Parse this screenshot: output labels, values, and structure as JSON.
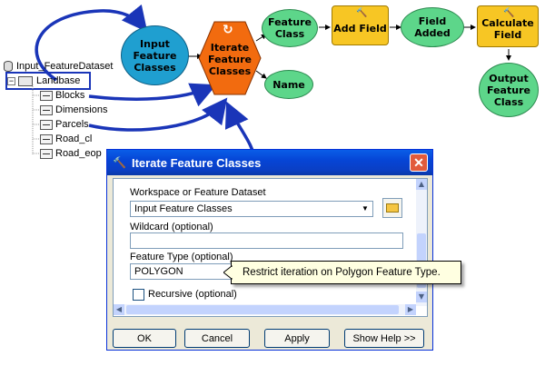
{
  "model": {
    "input_feature_classes": "Input Feature Classes",
    "iterate_feature_classes": "Iterate Feature Classes",
    "feature_class": "Feature Class",
    "name": "Name",
    "add_field": "Add Field",
    "field_added": "Field Added",
    "calculate_field": "Calculate Field",
    "output_feature_class": "Output Feature Class"
  },
  "tree": {
    "root": "Input_FeatureDataset",
    "group": "Landbase",
    "children": [
      "Blocks",
      "Dimensions",
      "Parcels",
      "Road_cl",
      "Road_eop"
    ]
  },
  "dialog": {
    "title": "Iterate Feature Classes",
    "workspace_label": "Workspace or Feature Dataset",
    "workspace_value": "Input Feature Classes",
    "wildcard_label": "Wildcard (optional)",
    "wildcard_value": "",
    "feature_type_label": "Feature Type (optional)",
    "feature_type_value": "POLYGON",
    "recursive_label": "Recursive (optional)",
    "buttons": {
      "ok": "OK",
      "cancel": "Cancel",
      "apply": "Apply",
      "show_help": "Show Help >>"
    }
  },
  "tooltip": "Restrict iteration on Polygon Feature Type.",
  "colors": {
    "input_node": "#1f9fd0",
    "iterator_node": "#f26b0f",
    "data_node": "#5dd68a",
    "tool_node": "#f7c624",
    "connector": "#1a35b8",
    "dialog_title": "#0a4fd8"
  }
}
